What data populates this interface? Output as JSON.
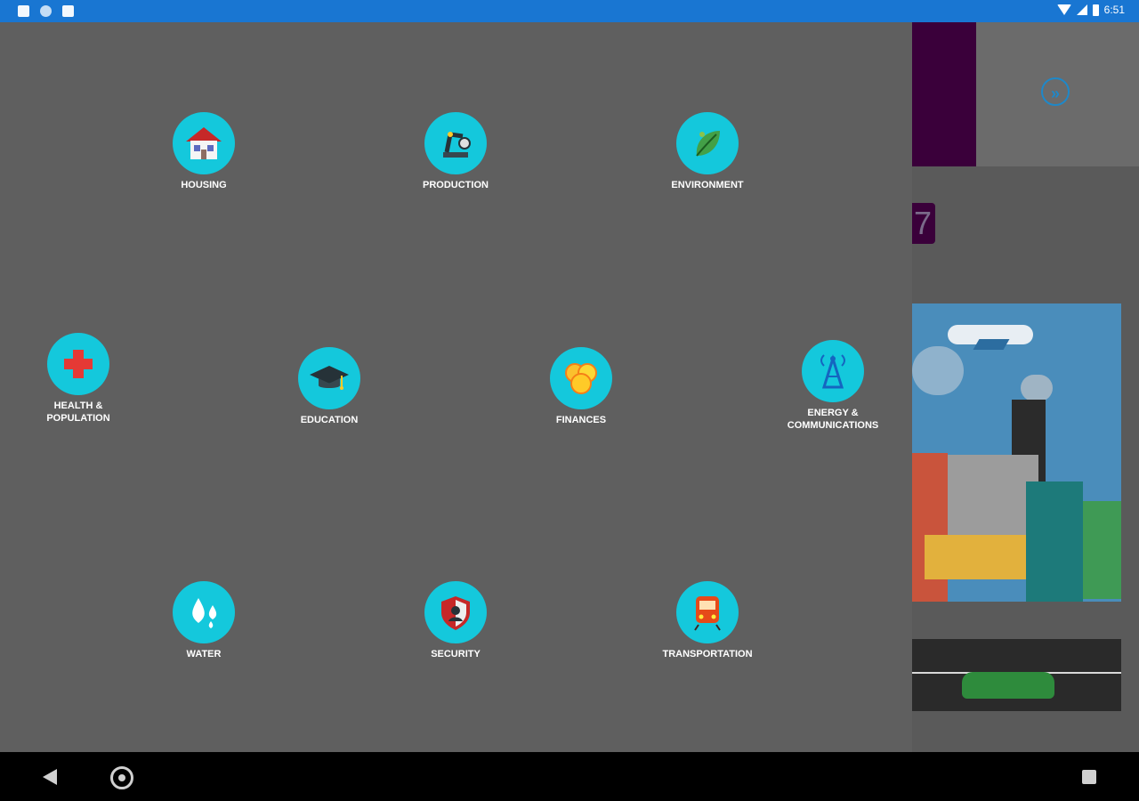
{
  "status_bar": {
    "time": "6:51",
    "icons": [
      "notification-icon",
      "sync-icon",
      "sd-card-icon",
      "wifi-icon",
      "signal-icon",
      "battery-icon"
    ]
  },
  "categories": [
    {
      "label": "HOUSING",
      "icon": "house-icon"
    },
    {
      "label": "PRODUCTION",
      "icon": "robot-arm-icon"
    },
    {
      "label": "ENVIRONMENT",
      "icon": "leaf-icon"
    },
    {
      "label": "HEALTH & POPULATION",
      "icon": "medical-cross-icon"
    },
    {
      "label": "EDUCATION",
      "icon": "graduation-cap-icon"
    },
    {
      "label": "FINANCES",
      "icon": "coins-icon"
    },
    {
      "label": "ENERGY & COMMUNICATIONS",
      "icon": "antenna-tower-icon"
    },
    {
      "label": "WATER",
      "icon": "water-drops-icon"
    },
    {
      "label": "SECURITY",
      "icon": "shield-icon"
    },
    {
      "label": "TRANSPORTATION",
      "icon": "train-icon"
    }
  ],
  "right_panel": {
    "next_icon": "double-chevron-right-icon",
    "page_badge": "7",
    "illustration": "city-illustration"
  },
  "colors": {
    "status_bar": "#1976d2",
    "overlay": "#5f5f5f",
    "icon_circle": "#14c8dc",
    "accent_purple": "#3a003a"
  }
}
